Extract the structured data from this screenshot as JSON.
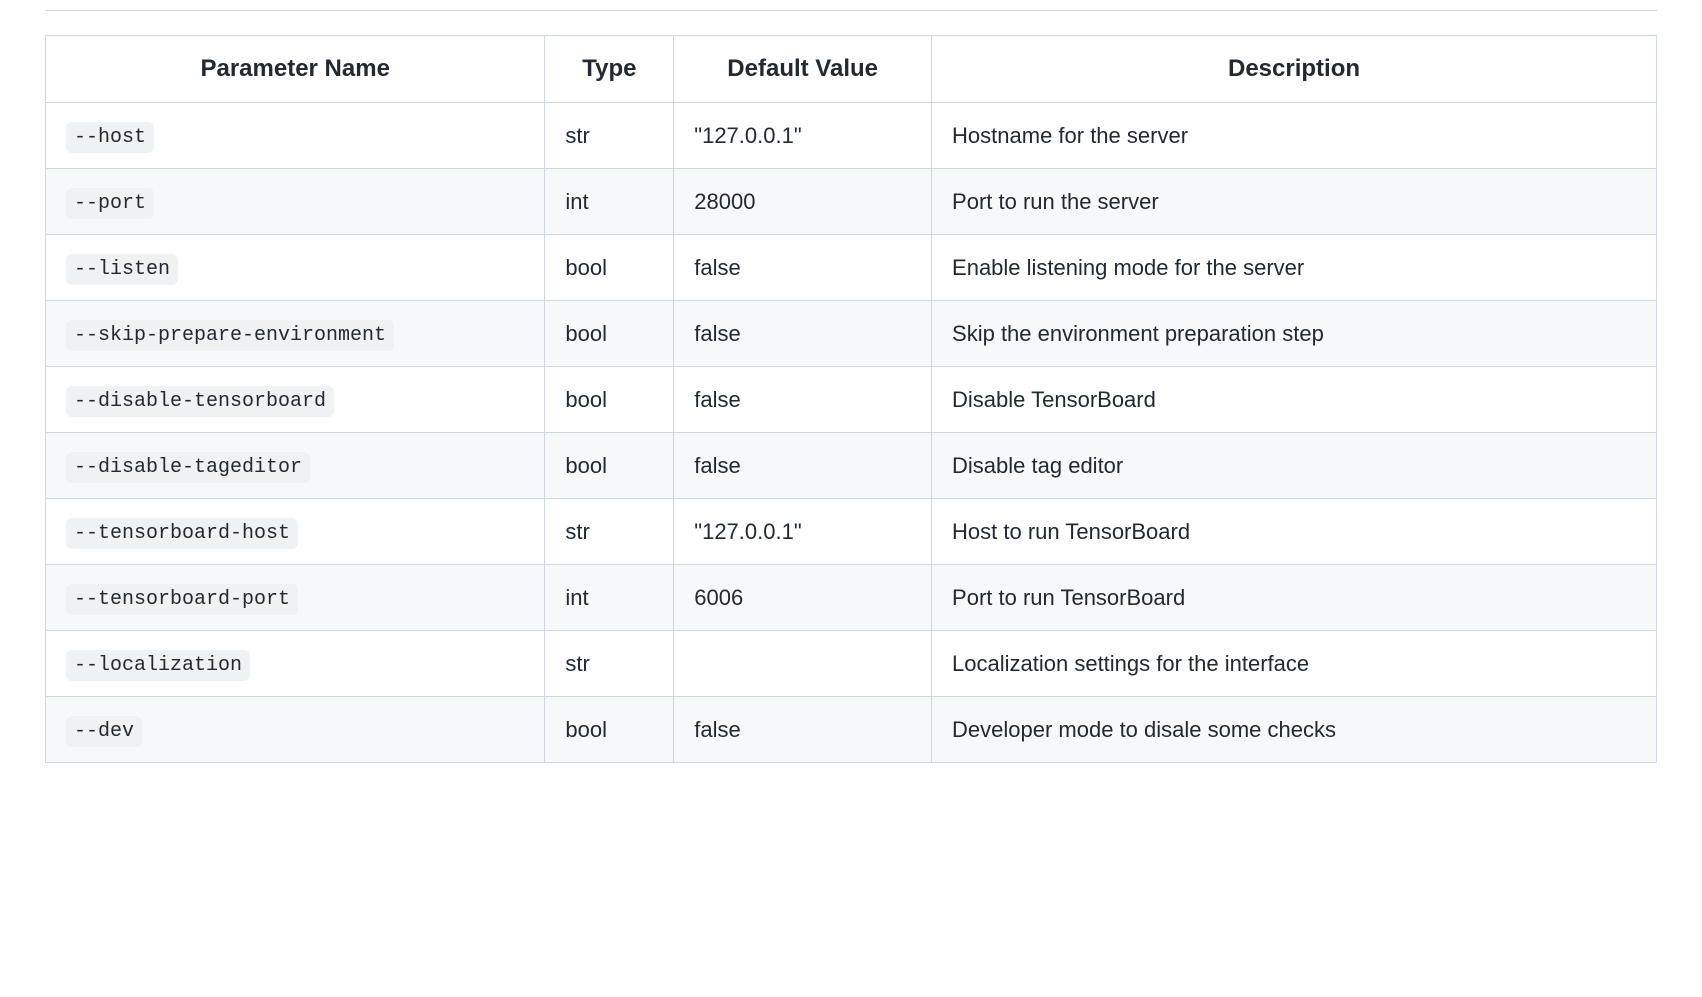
{
  "table": {
    "headers": {
      "param": "Parameter Name",
      "type": "Type",
      "default": "Default Value",
      "description": "Description"
    },
    "rows": [
      {
        "param": "--host",
        "type": "str",
        "default": "\"127.0.0.1\"",
        "description": "Hostname for the server"
      },
      {
        "param": "--port",
        "type": "int",
        "default": "28000",
        "description": "Port to run the server"
      },
      {
        "param": "--listen",
        "type": "bool",
        "default": "false",
        "description": "Enable listening mode for the server"
      },
      {
        "param": "--skip-prepare-environment",
        "type": "bool",
        "default": "false",
        "description": "Skip the environment preparation step"
      },
      {
        "param": "--disable-tensorboard",
        "type": "bool",
        "default": "false",
        "description": "Disable TensorBoard"
      },
      {
        "param": "--disable-tageditor",
        "type": "bool",
        "default": "false",
        "description": "Disable tag editor"
      },
      {
        "param": "--tensorboard-host",
        "type": "str",
        "default": "\"127.0.0.1\"",
        "description": "Host to run TensorBoard"
      },
      {
        "param": "--tensorboard-port",
        "type": "int",
        "default": "6006",
        "description": "Port to run TensorBoard"
      },
      {
        "param": "--localization",
        "type": "str",
        "default": "",
        "description": "Localization settings for the interface"
      },
      {
        "param": "--dev",
        "type": "bool",
        "default": "false",
        "description": "Developer mode to disale some checks"
      }
    ]
  }
}
